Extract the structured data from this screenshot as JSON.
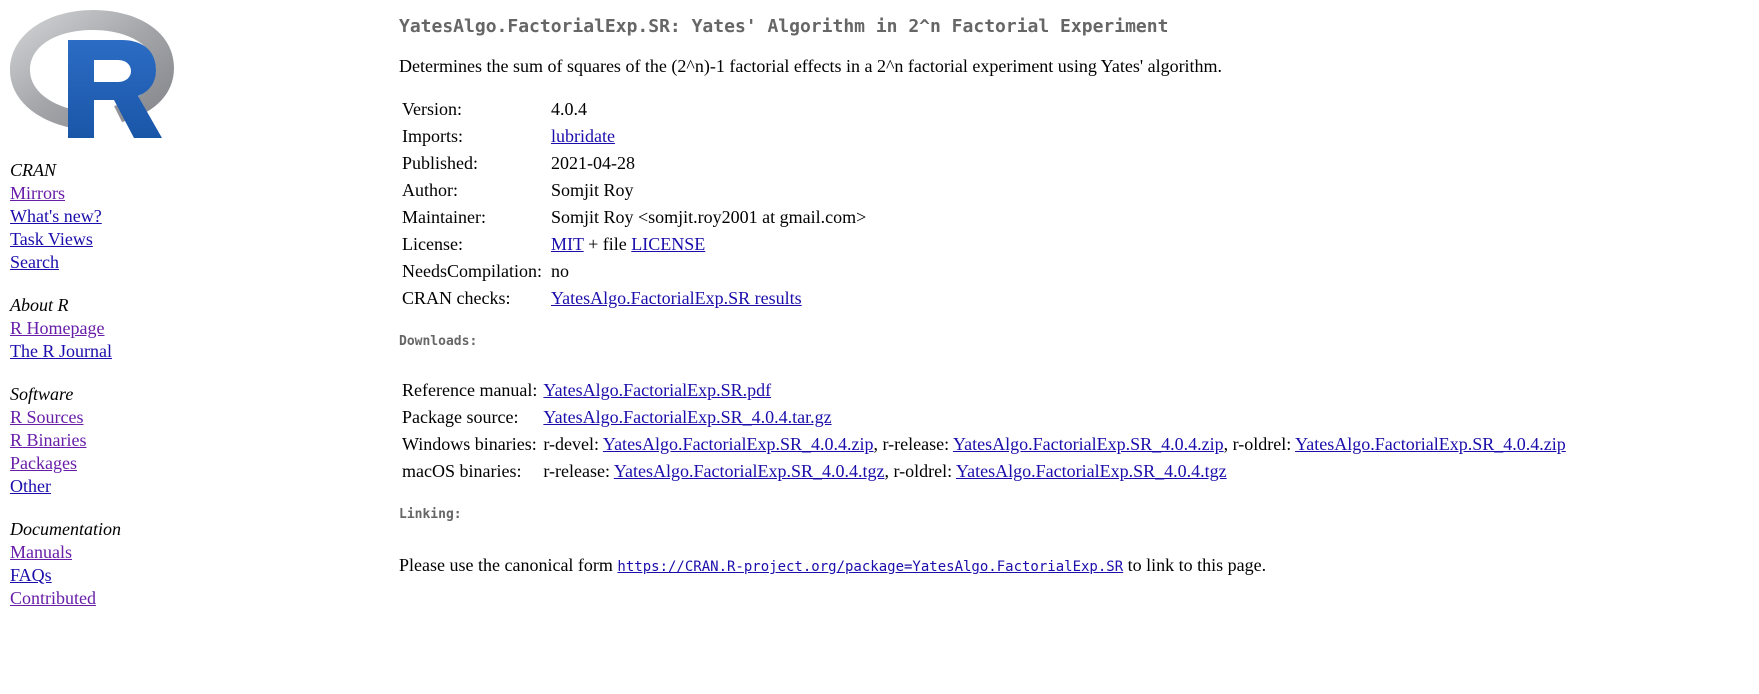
{
  "sidebar": {
    "logo_letter": "R",
    "groups": [
      {
        "heading": "CRAN",
        "links": [
          {
            "label": "Mirrors",
            "visited": true
          },
          {
            "label": "What's new?",
            "visited": false
          },
          {
            "label": "Task Views",
            "visited": false
          },
          {
            "label": "Search",
            "visited": false
          }
        ]
      },
      {
        "heading": "About R",
        "links": [
          {
            "label": "R Homepage",
            "visited": true
          },
          {
            "label": "The R Journal",
            "visited": false
          }
        ]
      },
      {
        "heading": "Software",
        "links": [
          {
            "label": "R Sources",
            "visited": true
          },
          {
            "label": "R Binaries",
            "visited": true
          },
          {
            "label": "Packages",
            "visited": true
          },
          {
            "label": "Other",
            "visited": false
          }
        ]
      },
      {
        "heading": "Documentation",
        "links": [
          {
            "label": "Manuals",
            "visited": true
          },
          {
            "label": "FAQs",
            "visited": false
          },
          {
            "label": "Contributed",
            "visited": true
          }
        ]
      }
    ]
  },
  "main": {
    "title": "YatesAlgo.FactorialExp.SR: Yates' Algorithm in 2^n Factorial Experiment",
    "description": "Determines the sum of squares of the (2^n)-1 factorial effects in a 2^n factorial experiment using Yates' algorithm.",
    "meta": {
      "version_key": "Version:",
      "version_val": "4.0.4",
      "imports_key": "Imports:",
      "imports_link": "lubridate",
      "published_key": "Published:",
      "published_val": "2021-04-28",
      "author_key": "Author:",
      "author_val": "Somjit Roy",
      "maintainer_key": "Maintainer:",
      "maintainer_val": "Somjit Roy <somjit.roy2001 at gmail.com>",
      "license_key": "License:",
      "license_link1": "MIT",
      "license_mid": " + file ",
      "license_link2": "LICENSE",
      "needs_key": "NeedsCompilation:",
      "needs_val": "no",
      "checks_key": "CRAN checks:",
      "checks_link": "YatesAlgo.FactorialExp.SR results"
    },
    "downloads_heading": "Downloads:",
    "downloads": {
      "refman_key": "Reference manual:",
      "refman_link": "YatesAlgo.FactorialExp.SR.pdf",
      "source_key": "Package source:",
      "source_link": "YatesAlgo.FactorialExp.SR_4.0.4.tar.gz",
      "win_key": "Windows binaries:",
      "win_devel_label": "r-devel: ",
      "win_devel_link": "YatesAlgo.FactorialExp.SR_4.0.4.zip",
      "win_release_label": ", r-release: ",
      "win_release_link": "YatesAlgo.FactorialExp.SR_4.0.4.zip",
      "win_oldrel_label": ", r-oldrel: ",
      "win_oldrel_link": "YatesAlgo.FactorialExp.SR_4.0.4.zip",
      "mac_key": "macOS binaries:",
      "mac_release_label": "r-release: ",
      "mac_release_link": "YatesAlgo.FactorialExp.SR_4.0.4.tgz",
      "mac_oldrel_label": ", r-oldrel: ",
      "mac_oldrel_link": "YatesAlgo.FactorialExp.SR_4.0.4.tgz"
    },
    "linking_heading": "Linking:",
    "linking": {
      "prefix": "Please use the canonical form ",
      "url": "https://CRAN.R-project.org/package=YatesAlgo.FactorialExp.SR",
      "suffix": " to link to this page."
    }
  },
  "colors": {
    "link": "#1a0dab",
    "visited_link": "#681da8",
    "heading_gray": "#666666",
    "logo_blue": "#2165b8",
    "logo_ring_gray": "#a7a9ad"
  }
}
